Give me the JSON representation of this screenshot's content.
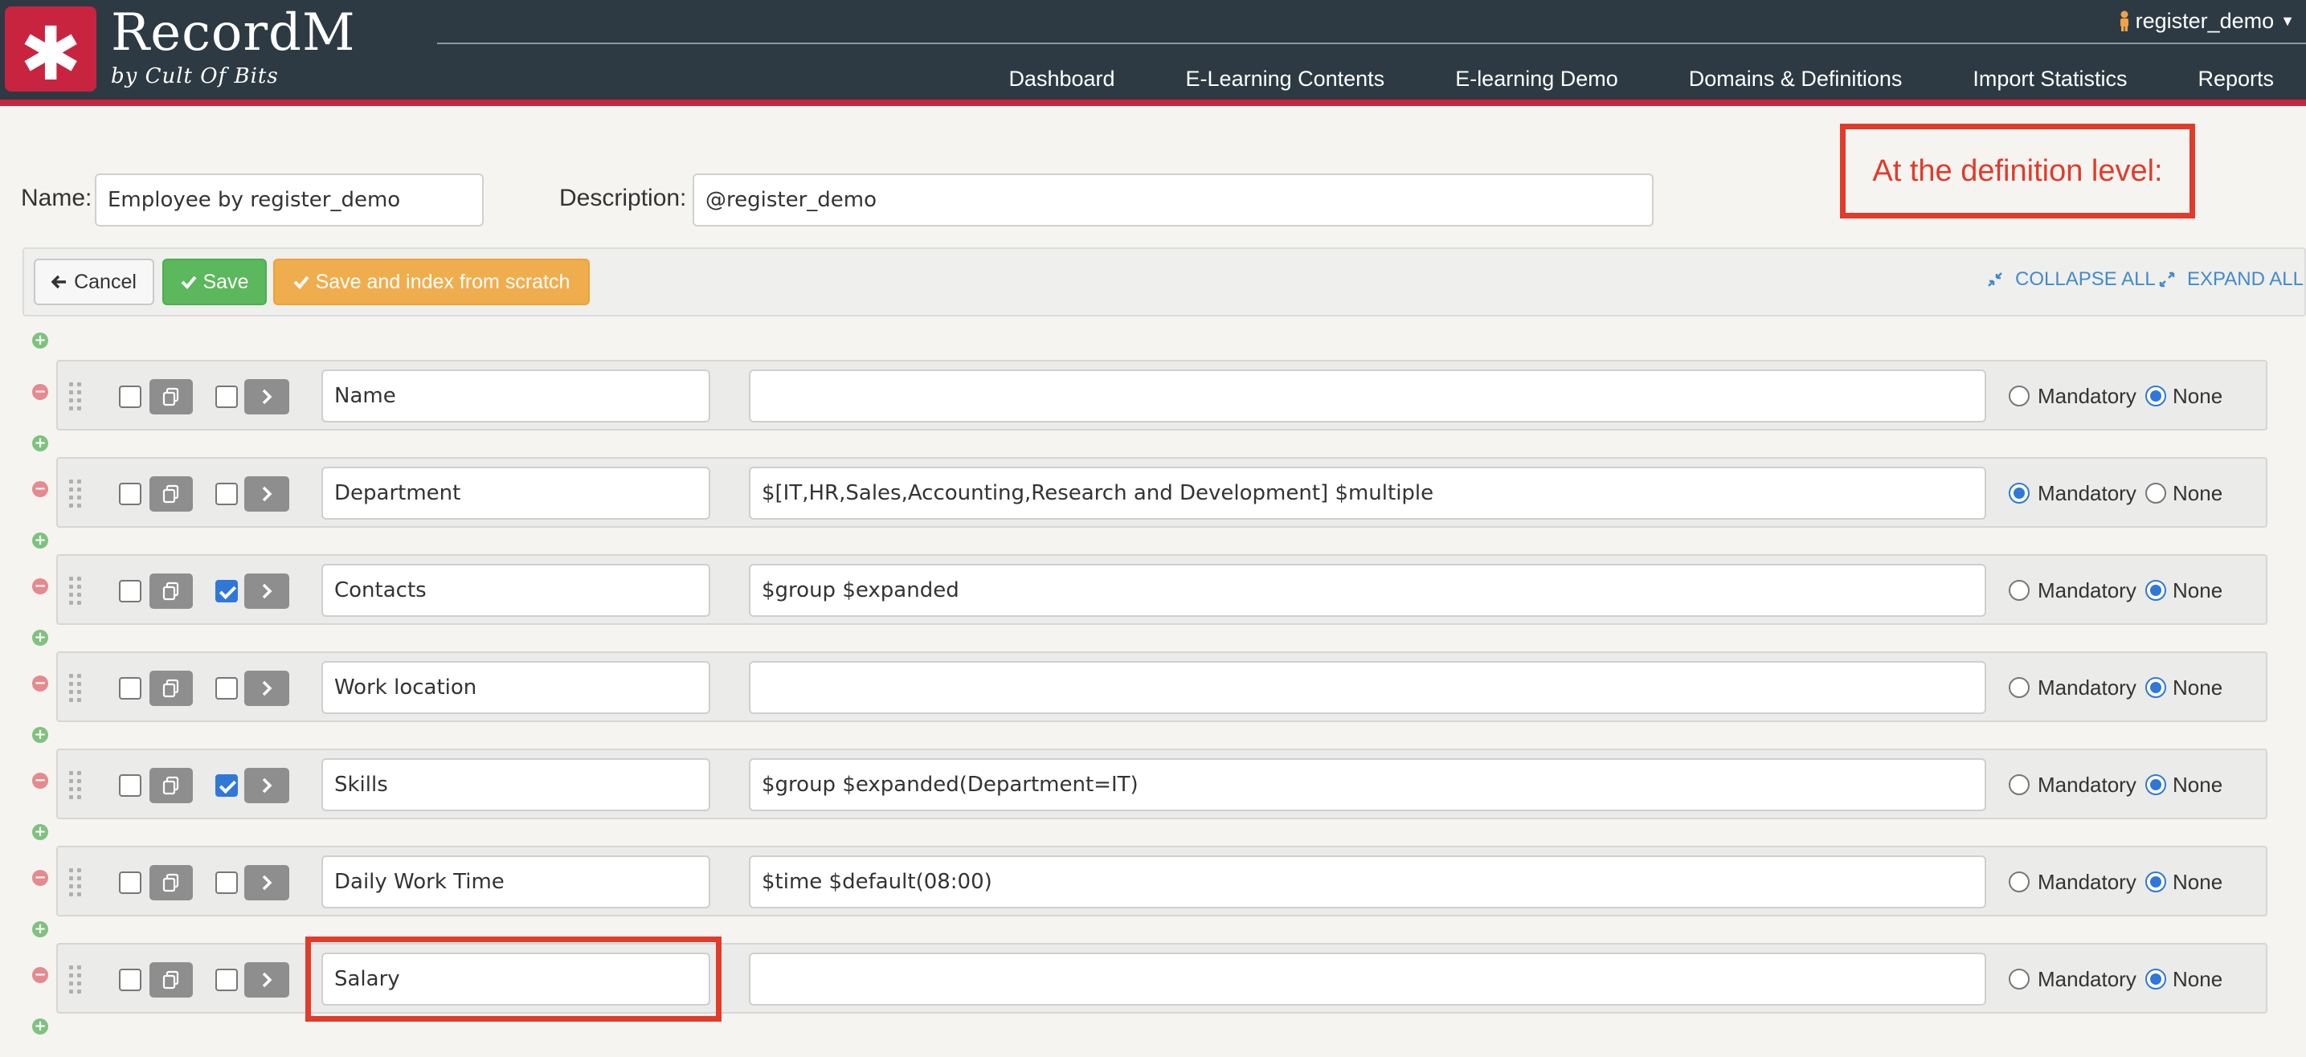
{
  "brand": {
    "title": "RecordM",
    "subtitle": "by Cult Of Bits"
  },
  "user": {
    "name": "register_demo"
  },
  "nav": {
    "items": [
      "Dashboard",
      "E-Learning Contents",
      "E-learning Demo",
      "Domains & Definitions",
      "Import Statistics",
      "Reports"
    ]
  },
  "form": {
    "name_label": "Name:",
    "name_value": "Employee by register_demo",
    "description_label": "Description:",
    "description_value": "@register_demo"
  },
  "annotation": {
    "text": "At the definition level:"
  },
  "toolbar": {
    "cancel_label": "Cancel",
    "save_label": "Save",
    "save_index_label": "Save and index from scratch",
    "collapse_all_label": "COLLAPSE ALL",
    "expand_all_label": "EXPAND ALL"
  },
  "radio_labels": {
    "mandatory": "Mandatory",
    "none": "None"
  },
  "fields": [
    {
      "name": "Name",
      "description": "",
      "group_checked": false,
      "required": "none"
    },
    {
      "name": "Department",
      "description": "$[IT,HR,Sales,Accounting,Research and Development] $multiple",
      "group_checked": false,
      "required": "mandatory"
    },
    {
      "name": "Contacts",
      "description": "$group $expanded",
      "group_checked": true,
      "required": "none"
    },
    {
      "name": "Work location",
      "description": "",
      "group_checked": false,
      "required": "none"
    },
    {
      "name": "Skills",
      "description": "$group $expanded(Department=IT)",
      "group_checked": true,
      "required": "none"
    },
    {
      "name": "Daily Work Time",
      "description": "$time $default(08:00)",
      "group_checked": false,
      "required": "none"
    },
    {
      "name": "Salary",
      "description": "",
      "group_checked": false,
      "required": "none"
    }
  ],
  "colors": {
    "header_bg": "#2d3a43",
    "brand_red": "#c8243f",
    "annotation_red": "#e23b2a",
    "save_green": "#5cb85c",
    "save_index_orange": "#f0ad4e",
    "link_blue": "#428bca"
  },
  "icons": {
    "logo": "asterisk-icon",
    "user": "person-icon",
    "cancel": "arrow-left-icon",
    "save": "checkmark-icon",
    "collapse": "collapse-arrows-icon",
    "expand": "expand-arrows-icon",
    "duplicate": "copy-icon",
    "open": "chevron-right-icon",
    "drag": "drag-handle-icon",
    "add": "plus-circle-icon",
    "remove": "minus-circle-icon"
  }
}
